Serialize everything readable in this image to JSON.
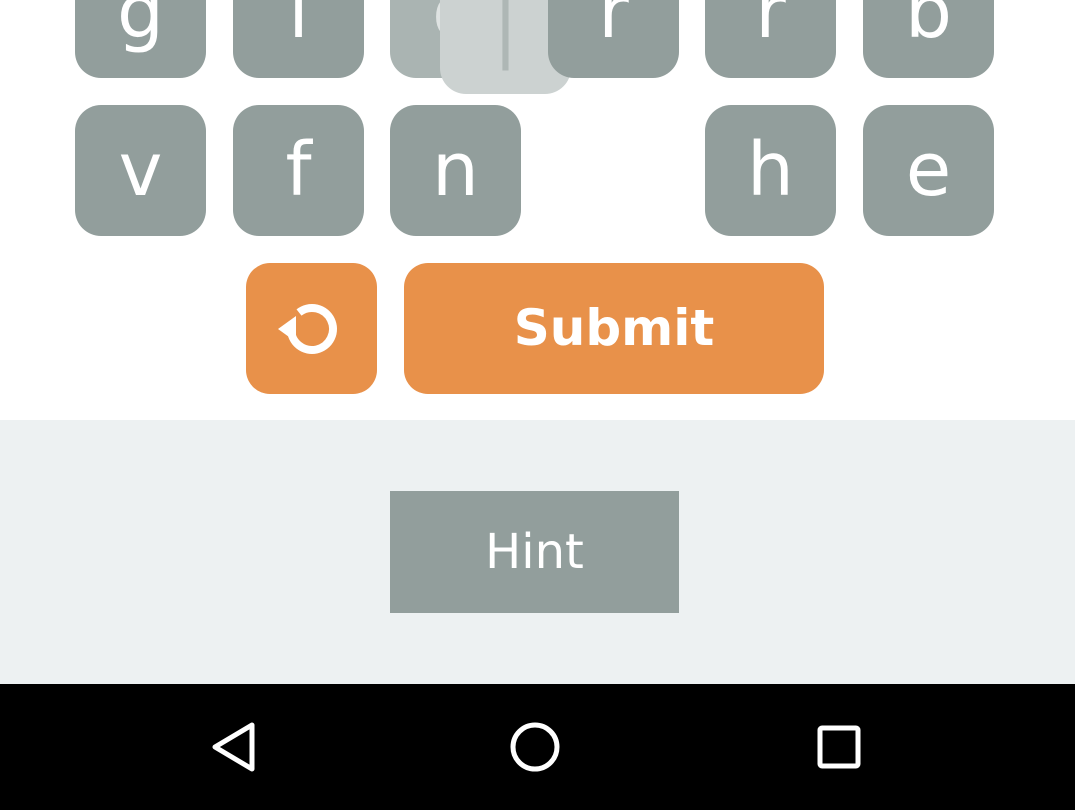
{
  "colors": {
    "tile": "#929e9c",
    "accent": "#e8914a",
    "hint_panel": "#edf1f2",
    "nav_bar": "#000000"
  },
  "tiles": {
    "row1": [
      "g",
      "i",
      "d",
      "r",
      "r",
      "b"
    ],
    "row2": [
      "v",
      "f",
      "n",
      "h",
      "e"
    ]
  },
  "dragging_tile": {
    "letter": "|"
  },
  "actions": {
    "reset_icon": "reset-icon",
    "submit_label": "Submit"
  },
  "hint": {
    "label": "Hint"
  },
  "nav": {
    "back_icon": "back-icon",
    "home_icon": "home-icon",
    "recents_icon": "recents-icon"
  }
}
